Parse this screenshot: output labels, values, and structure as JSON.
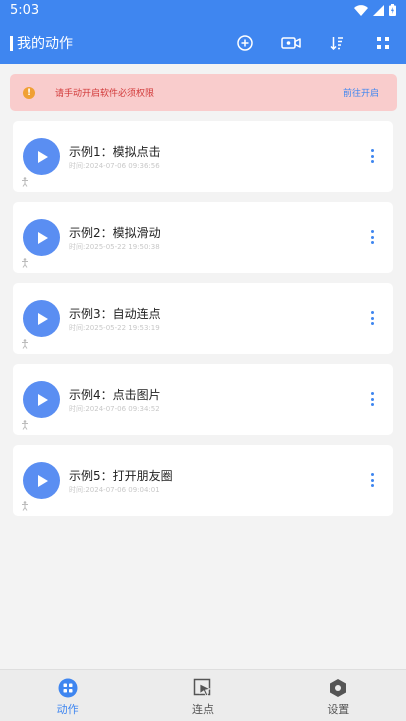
{
  "status_bar": {
    "time": "5:03"
  },
  "header": {
    "title": "我的动作"
  },
  "toolbar_icons": [
    "add-icon",
    "video-camera-icon",
    "sort-icon",
    "grid-icon"
  ],
  "warning": {
    "text": "请手动开启软件必须权限",
    "link": "前往开启"
  },
  "actions": [
    {
      "title": "示例1：模拟点击",
      "time": "时间:2024-07-06 09:36:56"
    },
    {
      "title": "示例2：模拟滑动",
      "time": "时间:2025-05-22 19:50:38"
    },
    {
      "title": "示例3：自动连点",
      "time": "时间:2025-05-22 19:53:19"
    },
    {
      "title": "示例4：点击图片",
      "time": "时间:2024-07-06 09:34:52"
    },
    {
      "title": "示例5：打开朋友圈",
      "time": "时间:2024-07-06 09:04:01"
    }
  ],
  "bottom_nav": [
    {
      "label": "动作",
      "active": true
    },
    {
      "label": "连点",
      "active": false
    },
    {
      "label": "设置",
      "active": false
    }
  ],
  "colors": {
    "primary": "#3f86f0",
    "warning_bg": "#f9cccc",
    "warning_text": "#d23a3a",
    "play_button": "#5a8ef2"
  }
}
